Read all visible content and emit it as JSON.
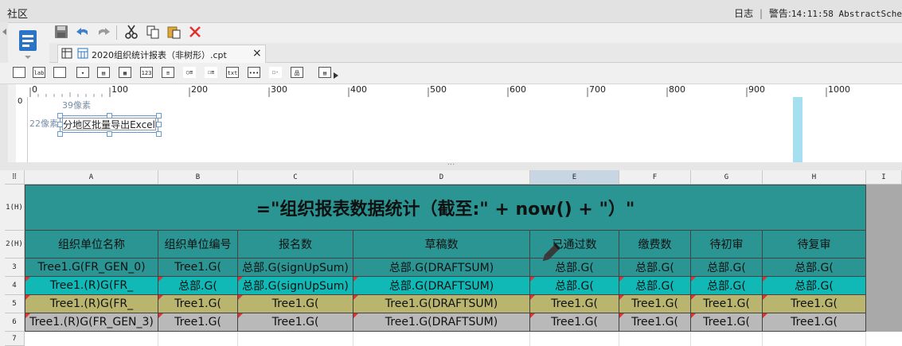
{
  "topbar": {
    "app_name": "社区",
    "log_label": "日志",
    "separator": "|",
    "warning_prefix": "警告:",
    "warning_text": "14:11:58 AbstractSche"
  },
  "file_tab": {
    "title": "2020组织统计报表（非树形）.cpt",
    "close": "×"
  },
  "ruler": {
    "marks": [
      "0",
      "100",
      "200",
      "300",
      "400",
      "500",
      "600",
      "700",
      "800",
      "900",
      "1000"
    ]
  },
  "canvas": {
    "vruler_zero": "0",
    "width_hint": "39像素",
    "height_hint": "22像素",
    "button_label": "分地区批量导出Excel"
  },
  "grid": {
    "columns": [
      "A",
      "B",
      "C",
      "D",
      "E",
      "F",
      "G",
      "H",
      "I"
    ],
    "rows": [
      "1(H)",
      "2(H)",
      "3",
      "4",
      "5",
      "6",
      "7"
    ],
    "title_formula": "=\"组织报表数据统计（截至:\" + now() + \"）\"",
    "headers": [
      "组织单位名称",
      "组织单位编号",
      "报名数",
      "草稿数",
      "已通过数",
      "缴费数",
      "待初审",
      "待复审"
    ],
    "data_rows": [
      [
        "Tree1.G(FR_GEN_0)",
        "Tree1.G(",
        "总部.G(signUpSum)",
        "总部.G(DRAFTSUM)",
        "总部.G(",
        "总部.G(",
        "总部.G(",
        "总部.G("
      ],
      [
        "Tree1.(R)G(FR_",
        "总部.G(",
        "总部.G(signUpSum)",
        "总部.G(DRAFTSUM)",
        "总部.G(",
        "总部.G(",
        "总部.G(",
        "总部.G("
      ],
      [
        "Tree1.(R)G(FR_",
        "Tree1.G(",
        "Tree1.G(",
        "Tree1.G(DRAFTSUM)",
        "Tree1.G(",
        "Tree1.G(",
        "Tree1.G(",
        "Tree1.G("
      ],
      [
        "Tree1.(R)G(FR_GEN_3)",
        "Tree1.G(",
        "Tree1.G(",
        "Tree1.G(DRAFTSUM)",
        "Tree1.G(",
        "Tree1.G(",
        "Tree1.G(",
        "Tree1.G("
      ]
    ]
  },
  "colors": {
    "title_bg": "#2a9593",
    "header_bg": "#2a9593",
    "row3_bg": "#2a9593",
    "row4_bg": "#10b8b6",
    "row5_bg": "#b9b56e",
    "row6_bg": "#b9b9b9",
    "selected_col_bg": "#c8d6e3"
  },
  "icons": [
    "template-icon",
    "save-icon",
    "undo-icon",
    "redo-icon",
    "cut-icon",
    "copy-icon",
    "paste-icon",
    "delete-icon",
    "grid-icon",
    "report-file-icon",
    "pencil-cursor-icon"
  ]
}
